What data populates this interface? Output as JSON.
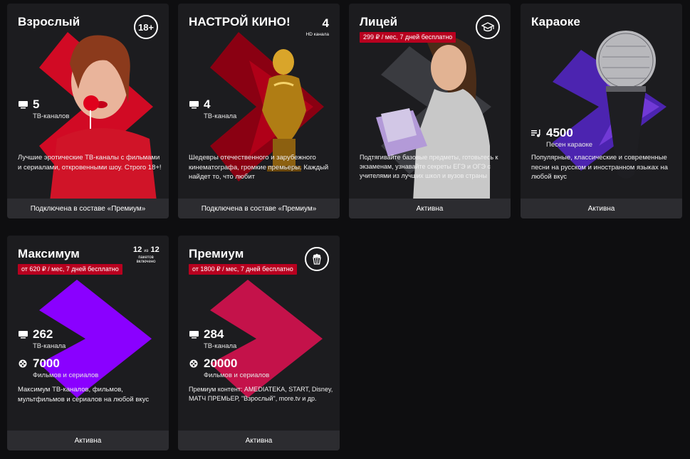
{
  "cards": [
    {
      "title": "Взрослый",
      "badge": "18+",
      "stat1_value": "5",
      "stat1_label": "ТВ-каналов",
      "description": "Лучшие эротические ТВ-каналы с фильмами и сериалами, откровенными шоу. Строго 18+!",
      "status": "Подключена в составе «Премиум»",
      "icon": "tv-icon",
      "accent": "#d10a24"
    },
    {
      "title": "НАСТРОЙ КИНО!",
      "hd_count": "4",
      "hd_label": "HD канала",
      "stat1_value": "4",
      "stat1_label": "ТВ-канала",
      "description": "Шедевры отечественного и зарубежного кинематографа, громкие премьеры. Каждый найдет то, что любит",
      "status": "Подключена в составе «Премиум»",
      "icon": "tv-icon",
      "accent": "#a00016"
    },
    {
      "title": "Лицей",
      "price": "299 ₽ / мес, 7 дней бесплатно",
      "badge_icon": "graduation-cap-icon",
      "description": "Подтягивайте базовые предметы, готовьтесь к экзаменам, узнавайте секреты ЕГЭ и ОГЭ с учителями из лучших школ и вузов страны",
      "status": "Активна",
      "accent": "#3a3b40"
    },
    {
      "title": "Караоке",
      "stat1_value": "4500",
      "stat1_label": "Песен караоке",
      "description": "Популярные, классические и современные песни на русском и иностранном языках на любой вкус",
      "status": "Активна",
      "icon": "music-list-icon",
      "accent": "#5b2fc4"
    },
    {
      "title": "Максимум",
      "price": "от 620 ₽ / мес, 7 дней бесплатно",
      "packages_a": "12",
      "packages_of": "из",
      "packages_b": "12",
      "packages_label": "пакетов включено",
      "stat1_value": "262",
      "stat1_label": "ТВ-канала",
      "stat2_value": "7000",
      "stat2_label": "Фильмов и сериалов",
      "description": "Максимум ТВ-каналов, фильмов, мультфильмов и сериалов на любой вкус",
      "status": "Активна",
      "accent": "#8a00ff"
    },
    {
      "title": "Премиум",
      "price": "от 1800 ₽ / мес, 7 дней бесплатно",
      "badge_icon": "popcorn-icon",
      "stat1_value": "284",
      "stat1_label": "ТВ-канала",
      "stat2_value": "20000",
      "stat2_label": "Фильмов и сериалов",
      "description": "Премиум контент: AMEDIATEKA, START, Disney, МАТЧ ПРЕМЬЕР, \"Взрослый\", more.tv и др.",
      "status": "Активна",
      "accent": "#c4124a"
    }
  ]
}
